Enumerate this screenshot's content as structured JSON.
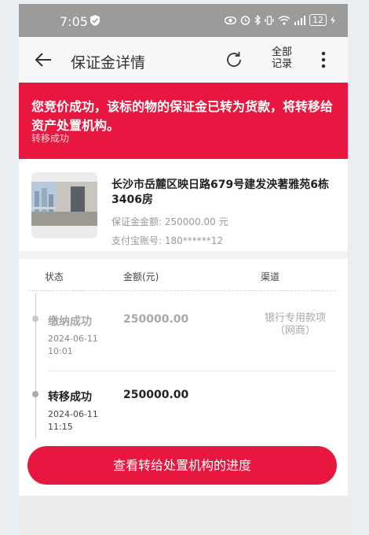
{
  "status_bar": {
    "time": "7:05",
    "battery": "12",
    "icons": [
      "shield-check-icon",
      "eye-icon",
      "alarm-icon",
      "bluetooth-icon",
      "vibrate-icon",
      "wifi-icon",
      "signal-icon",
      "charging-icon"
    ]
  },
  "header": {
    "title": "保证金详情",
    "records_line1": "全部",
    "records_line2": "记录"
  },
  "banner": {
    "message": "您竞价成功，该标的物的保证金已转为货款，将转移给资产处置机构。",
    "status": "转移成功"
  },
  "asset": {
    "name": "长沙市岳麓区映日路679号建发泱著雅苑6栋3406房",
    "deposit_label": "保证金金额:",
    "deposit_value": "250000.00 元",
    "alipay_label": "支付宝账号:",
    "alipay_value": "180******12"
  },
  "table": {
    "headers": [
      "状态",
      "金额(元)",
      "渠道"
    ],
    "rows": [
      {
        "status": "缴纳成功",
        "date": "2024-06-11",
        "time": "10:01",
        "amount": "250000.00",
        "channel_line1": "银行专用款项",
        "channel_line2": "（网商）"
      },
      {
        "status": "转移成功",
        "date": "2024-06-11",
        "time": "11:15",
        "amount": "250000.00",
        "channel_line1": "",
        "channel_line2": ""
      }
    ]
  },
  "action": {
    "label": "查看转给处置机构的进度"
  },
  "colors": {
    "accent": "#e8173f",
    "status_bar": "#9b9b9b"
  }
}
